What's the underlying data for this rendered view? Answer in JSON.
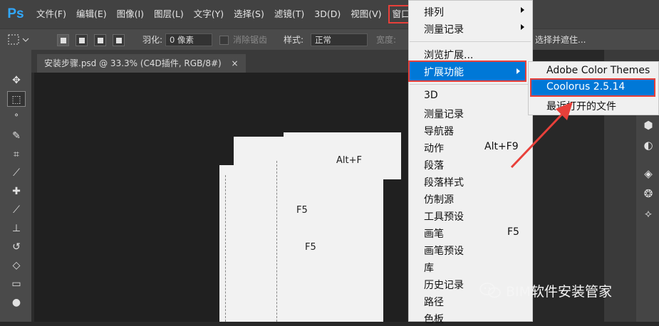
{
  "menubar": {
    "logo": "Ps",
    "items": [
      "文件(F)",
      "编辑(E)",
      "图像(I)",
      "图层(L)",
      "文字(Y)",
      "选择(S)",
      "滤镜(T)",
      "3D(D)",
      "视图(V)",
      "窗口(W)"
    ]
  },
  "options": {
    "feather_label": "羽化:",
    "feather_value": "0 像素",
    "antialias_label": "消除锯齿",
    "style_label": "样式:",
    "style_value": "正常",
    "width_label": "宽度:",
    "select_mask_button": "选择并遮住..."
  },
  "document": {
    "tab_title": "安装步骤.psd @ 33.3% (C4D插件, RGB/8#)",
    "close_glyph": "×",
    "fragments": [
      "Alt+F",
      "F5",
      "F5"
    ]
  },
  "window_menu": {
    "items": [
      {
        "label": "排列",
        "submenu": true
      },
      {
        "label": "测量记录",
        "submenu": true
      },
      {
        "label": "浏览扩展...",
        "submenu": false
      },
      {
        "label": "扩展功能",
        "submenu": true,
        "highlighted": true
      },
      {
        "label": "3D",
        "shortcut": ""
      },
      {
        "label": "测量记录",
        "shortcut": ""
      },
      {
        "label": "导航器",
        "shortcut": ""
      },
      {
        "label": "动作",
        "shortcut": "Alt+F9"
      },
      {
        "label": "段落",
        "shortcut": ""
      },
      {
        "label": "段落样式",
        "shortcut": ""
      },
      {
        "label": "仿制源",
        "shortcut": ""
      },
      {
        "label": "工具预设",
        "shortcut": ""
      },
      {
        "label": "画笔",
        "shortcut": "F5"
      },
      {
        "label": "画笔预设",
        "shortcut": ""
      },
      {
        "label": "库",
        "shortcut": ""
      },
      {
        "label": "历史记录",
        "shortcut": ""
      },
      {
        "label": "路径",
        "shortcut": ""
      },
      {
        "label": "色板",
        "shortcut": ""
      }
    ]
  },
  "extensions_submenu": {
    "items": [
      {
        "label": "Adobe Color Themes"
      },
      {
        "label": "Coolorus 2.5.14",
        "highlighted": true
      },
      {
        "label": "最近打开的文件"
      }
    ]
  },
  "watermark": {
    "text": "BIM软件安装管家",
    "icon": "wechat-icon"
  },
  "colors": {
    "highlight": "#0078d7",
    "annotation_red": "#e8403a",
    "ps_blue": "#31a8ff"
  }
}
